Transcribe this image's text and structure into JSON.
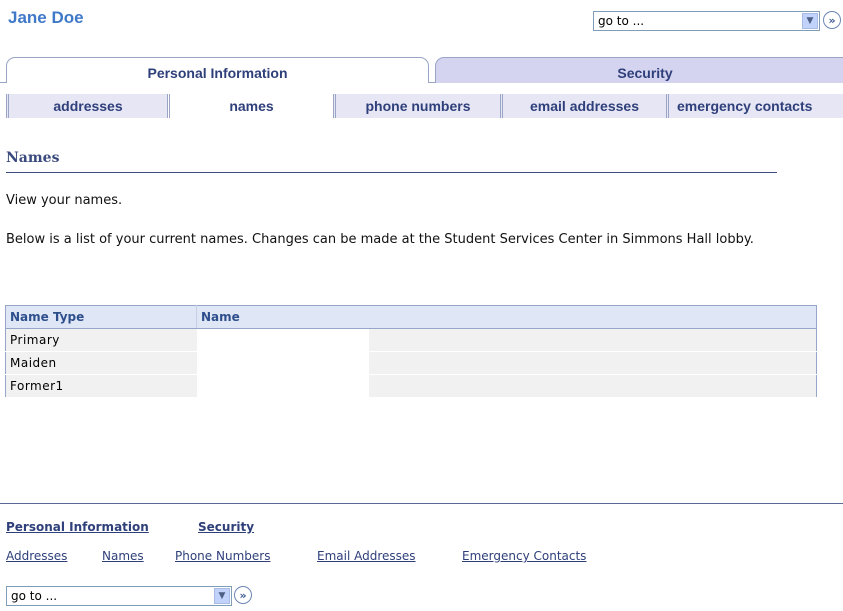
{
  "header": {
    "user_name": "Jane Doe",
    "goto_label": "go to ..."
  },
  "tabs": {
    "main": [
      {
        "label": "Personal Information",
        "active": true
      },
      {
        "label": "Security",
        "active": false
      }
    ],
    "sub": [
      {
        "label": "addresses",
        "active": false
      },
      {
        "label": "names",
        "active": true
      },
      {
        "label": "phone numbers",
        "active": false
      },
      {
        "label": "email addresses",
        "active": false
      },
      {
        "label": "emergency contacts",
        "active": false
      }
    ]
  },
  "section": {
    "title": "Names",
    "intro": "View your names.",
    "description": "Below is a list of your current names. Changes can be made at the Student Services Center in Simmons Hall lobby."
  },
  "table": {
    "columns": [
      "Name Type",
      "Name"
    ],
    "rows": [
      {
        "type": "Primary",
        "name": ""
      },
      {
        "type": "Maiden",
        "name": ""
      },
      {
        "type": "Former1",
        "name": ""
      }
    ]
  },
  "footer": {
    "top_links": [
      "Personal Information",
      "Security"
    ],
    "sub_links": [
      "Addresses",
      "Names",
      "Phone Numbers",
      "Email Addresses",
      "Emergency Contacts"
    ],
    "goto_label": "go to ..."
  },
  "icons": {
    "dropdown": "chevron-down-icon",
    "go": "double-chevron-right-icon"
  },
  "colors": {
    "accent": "#3f79c8",
    "tab_text": "#2e3f7a",
    "tab_inactive_bg": "#d4d4f0",
    "table_header_bg": "#dfe7f6"
  }
}
